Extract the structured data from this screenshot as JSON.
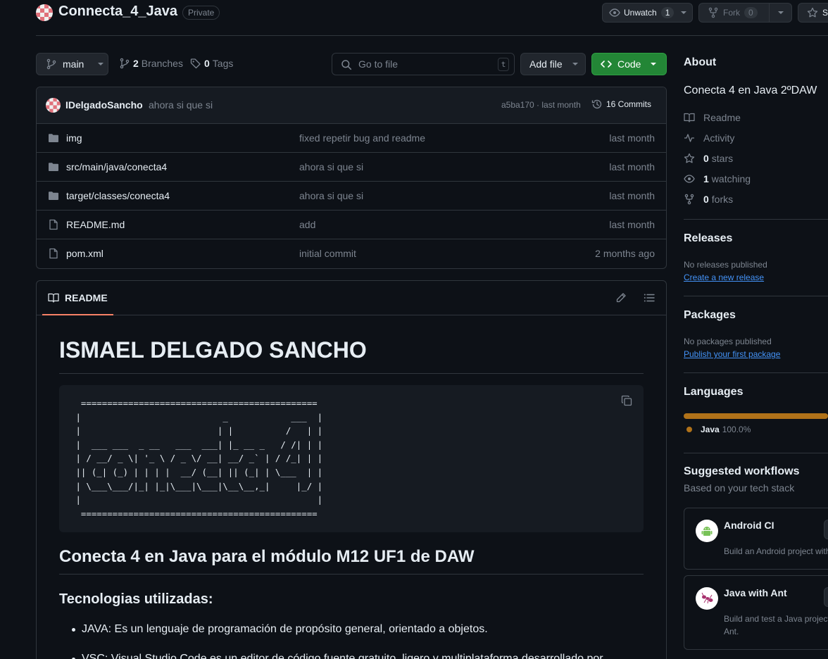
{
  "repo": {
    "name": "Connecta_4_Java",
    "visibility": "Private",
    "unwatch_label": "Unwatch",
    "watch_count": "1",
    "fork_label": "Fork",
    "fork_count": "0",
    "star_label": "S"
  },
  "toolbar": {
    "branch": "main",
    "branches_count": "2",
    "branches_label": "Branches",
    "tags_count": "0",
    "tags_label": "Tags",
    "search_placeholder": "Go to file",
    "search_shortcut": "t",
    "add_file_label": "Add file",
    "code_label": "Code"
  },
  "commit": {
    "author": "IDelgadoSancho",
    "message": "ahora si que si",
    "hash_time": "a5ba170 · last month",
    "commits_label": "16 Commits"
  },
  "files": [
    {
      "name": "img",
      "type": "folder",
      "message": "fixed repetir bug and readme",
      "date": "last month"
    },
    {
      "name": "src/main/java/conecta4",
      "type": "folder",
      "message": "ahora si que si",
      "date": "last month"
    },
    {
      "name": "target/classes/conecta4",
      "type": "folder",
      "message": "ahora si que si",
      "date": "last month"
    },
    {
      "name": "README.md",
      "type": "file",
      "message": "add",
      "date": "last month"
    },
    {
      "name": "pom.xml",
      "type": "file",
      "message": "initial commit",
      "date": "2 months ago"
    }
  ],
  "readme": {
    "tab_label": "README",
    "h1": "ISMAEL DELGADO SANCHO",
    "ascii_art": "  =============================================\n |                           _            ___  |\n |                          | |          /   | |\n |  ___ ___  _ __   ___  ___| |_ __ _   / /| | |\n | / __/ _ \\| '_ \\ / _ \\/ __| __/ _` | / /_| | |\n || (_| (_) | | | |  __/ (__| || (_| | \\___  | |\n | \\___\\___/|_| |_|\\___|\\___|\\__\\__,_|     |_/ |\n |                                             |\n  =============================================",
    "h2": "Conecta 4 en Java para el módulo M12 UF1 de DAW",
    "h3": "Tecnologias utilizadas:",
    "list": [
      "JAVA: Es un lenguaje de programación de propósito general, orientado a objetos.",
      "VSC: Visual Studio Code es un editor de código fuente gratuito, ligero y multiplataforma desarrollado por"
    ]
  },
  "sidebar": {
    "about_title": "About",
    "description": "Conecta 4 en Java 2ºDAW",
    "readme": "Readme",
    "activity": "Activity",
    "stars_count": "0",
    "stars_label": "stars",
    "watching_count": "1",
    "watching_label": "watching",
    "forks_count": "0",
    "forks_label": "forks",
    "releases_title": "Releases",
    "no_releases": "No releases published",
    "create_release": "Create a new release",
    "packages_title": "Packages",
    "no_packages": "No packages published",
    "publish_package": "Publish your first package",
    "languages_title": "Languages",
    "language_name": "Java",
    "language_percent": "100.0%",
    "language_color": "#b07219",
    "workflows_title": "Suggested workflows",
    "workflows_subtitle": "Based on your tech stack",
    "workflows": [
      {
        "title": "Android CI",
        "desc1": "Build an Android project with",
        "desc2": ""
      },
      {
        "title": "Java with Ant",
        "desc1": "Build and test a Java project",
        "desc2": "Ant."
      }
    ]
  },
  "colors": {
    "accent_green": "#238636",
    "link_blue": "#4493f8",
    "tab_underline": "#f78166"
  }
}
